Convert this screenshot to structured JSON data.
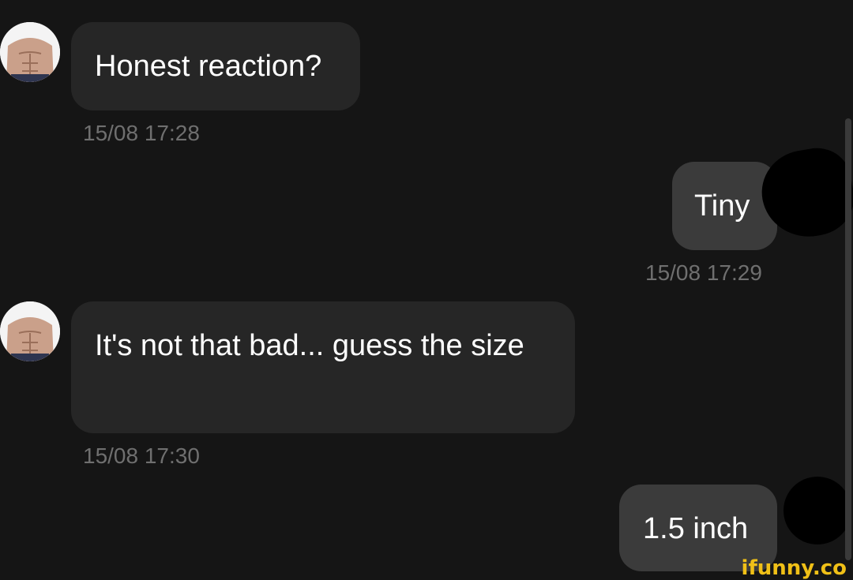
{
  "messages": [
    {
      "direction": "incoming",
      "text": "Honest reaction?",
      "timestamp": "15/08 17:28"
    },
    {
      "direction": "outgoing",
      "text": "Tiny",
      "timestamp": "15/08 17:29"
    },
    {
      "direction": "incoming",
      "text": "It's not that bad... guess the size",
      "timestamp": "15/08 17:30"
    },
    {
      "direction": "outgoing",
      "text": "1.5 inch",
      "timestamp": ""
    }
  ],
  "watermark": "ifunny.co",
  "colors": {
    "background": "#151515",
    "incoming_bubble": "#262626",
    "outgoing_bubble": "#3b3b3b",
    "timestamp_text": "#6f6f6f",
    "watermark": "#f0c017"
  },
  "icons": {
    "contact_avatar": "avatar-icon"
  }
}
